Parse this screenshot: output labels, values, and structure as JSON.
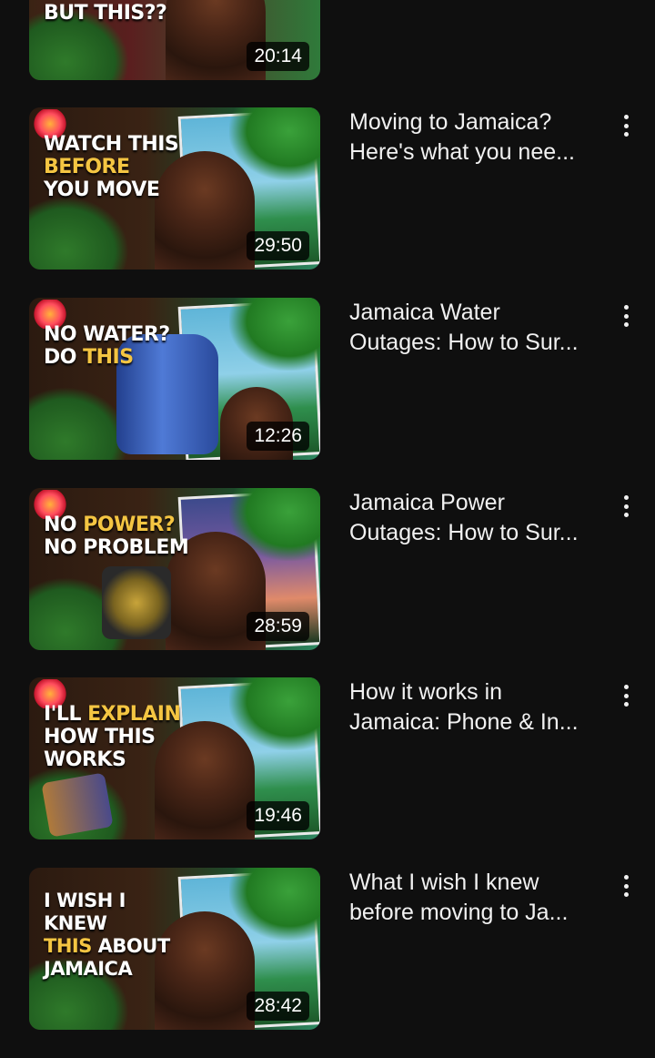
{
  "colors": {
    "background": "#0f0f0f",
    "text": "#f1f1f1",
    "thumb_highlight": "#f4c542"
  },
  "videos": [
    {
      "thumb_line1": "BUT THIS??",
      "duration": "20:14",
      "title": ""
    },
    {
      "thumb_line1": "WATCH THIS",
      "thumb_line2": "BEFORE",
      "thumb_line3": "YOU MOVE",
      "duration": "29:50",
      "title": "Moving to Jamaica?\nHere's what you nee..."
    },
    {
      "thumb_line1": "NO WATER?",
      "thumb_line2": "DO",
      "thumb_line2_hl": "THIS",
      "duration": "12:26",
      "title": "Jamaica Water\nOutages: How to Sur..."
    },
    {
      "thumb_line1_pre": "NO",
      "thumb_line1_hl": "POWER?",
      "thumb_line2": "NO PROBLEM",
      "duration": "28:59",
      "title": "Jamaica Power\nOutages: How to Sur..."
    },
    {
      "thumb_line1_pre": "I'LL",
      "thumb_line1_hl": "EXPLAIN",
      "thumb_line2": "HOW THIS",
      "thumb_line3": "WORKS",
      "duration": "19:46",
      "title": "How it works in\nJamaica: Phone & In..."
    },
    {
      "thumb_line1": "I WISH I KNEW",
      "thumb_line2_hl": "THIS",
      "thumb_line2": "ABOUT",
      "thumb_line3": "JAMAICA",
      "duration": "28:42",
      "title": "What I wish I knew\nbefore moving to Ja..."
    }
  ],
  "icons": {
    "menu": "more-vert-icon"
  }
}
